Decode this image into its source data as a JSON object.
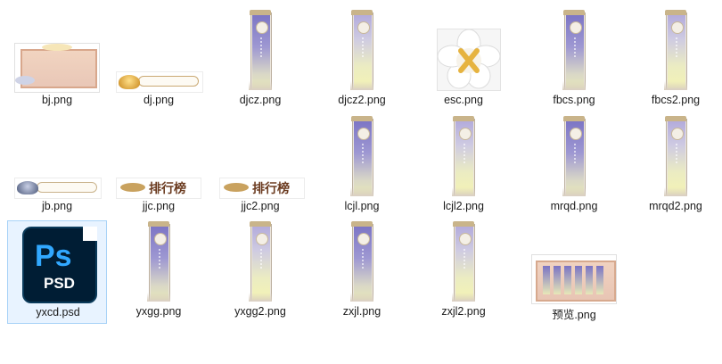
{
  "files": [
    {
      "id": "bj",
      "name": "bj.png",
      "kind": "frame-image"
    },
    {
      "id": "dj",
      "name": "dj.png",
      "kind": "gold-bar"
    },
    {
      "id": "djcz",
      "name": "djcz.png",
      "kind": "banner"
    },
    {
      "id": "djcz2",
      "name": "djcz2.png",
      "kind": "banner-light"
    },
    {
      "id": "esc",
      "name": "esc.png",
      "kind": "close-flower"
    },
    {
      "id": "fbcs",
      "name": "fbcs.png",
      "kind": "banner"
    },
    {
      "id": "fbcs2",
      "name": "fbcs2.png",
      "kind": "banner-light"
    },
    {
      "id": "jb",
      "name": "jb.png",
      "kind": "silver-bar"
    },
    {
      "id": "jjc",
      "name": "jjc.png",
      "kind": "ranking-title"
    },
    {
      "id": "jjc2",
      "name": "jjc2.png",
      "kind": "ranking-title"
    },
    {
      "id": "lcjl",
      "name": "lcjl.png",
      "kind": "banner"
    },
    {
      "id": "lcjl2",
      "name": "lcjl2.png",
      "kind": "banner-light"
    },
    {
      "id": "mrqd",
      "name": "mrqd.png",
      "kind": "banner"
    },
    {
      "id": "mrqd2",
      "name": "mrqd2.png",
      "kind": "banner-light"
    },
    {
      "id": "yxcd",
      "name": "yxcd.psd",
      "kind": "psd",
      "selected": true
    },
    {
      "id": "yxgg",
      "name": "yxgg.png",
      "kind": "banner"
    },
    {
      "id": "yxgg2",
      "name": "yxgg2.png",
      "kind": "banner-light"
    },
    {
      "id": "zxjl",
      "name": "zxjl.png",
      "kind": "banner"
    },
    {
      "id": "zxjl2",
      "name": "zxjl2.png",
      "kind": "banner-light"
    },
    {
      "id": "preview",
      "name": "预览.png",
      "kind": "preview-image"
    }
  ],
  "thumb_text": {
    "ranking": "排行榜",
    "psd_logo": "Ps",
    "psd_ext": "PSD"
  },
  "colors": {
    "selection_bg": "#e8f3ff",
    "selection_border": "#a8d2f7",
    "banner_purple": "#7a73c4",
    "banner_yellow": "#e8e8b8",
    "ps_dark": "#001d34",
    "ps_blue": "#31a8ff"
  }
}
